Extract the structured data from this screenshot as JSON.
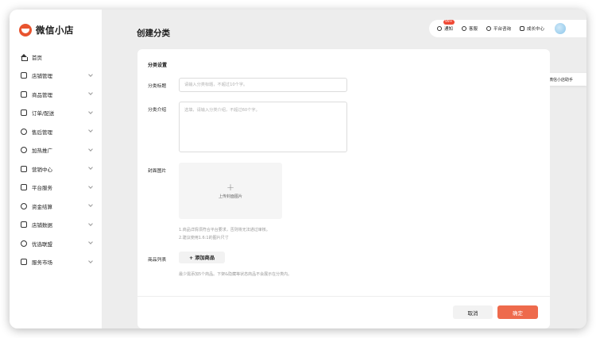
{
  "brand": {
    "name": "微信小店",
    "color": "#e8542f"
  },
  "sidebar": {
    "items": [
      {
        "label": "首页",
        "icon": "home-icon",
        "expandable": false
      },
      {
        "label": "店铺管理",
        "icon": "shop-icon",
        "expandable": true
      },
      {
        "label": "商品管理",
        "icon": "bag-icon",
        "expandable": true
      },
      {
        "label": "订单/配送",
        "icon": "order-icon",
        "expandable": true
      },
      {
        "label": "售后管理",
        "icon": "headset-icon",
        "expandable": true
      },
      {
        "label": "加热推广",
        "icon": "share-icon",
        "expandable": true
      },
      {
        "label": "营销中心",
        "icon": "ticket-icon",
        "expandable": true
      },
      {
        "label": "平台服务",
        "icon": "briefcase-icon",
        "expandable": true
      },
      {
        "label": "资金结算",
        "icon": "coin-icon",
        "expandable": true
      },
      {
        "label": "店铺数据",
        "icon": "chart-icon",
        "expandable": true
      },
      {
        "label": "优选联盟",
        "icon": "network-icon",
        "expandable": true
      },
      {
        "label": "服务市场",
        "icon": "grid-icon",
        "expandable": true
      }
    ]
  },
  "header": {
    "page_title": "创建分类",
    "notifications": {
      "label": "通知",
      "badge": "99+"
    },
    "service": {
      "label": "客服"
    },
    "consult": {
      "label": "平台咨询"
    },
    "growth": {
      "label": "成长中心"
    }
  },
  "float": {
    "download_label": "下载微信小店助手"
  },
  "form": {
    "section_title": "分类设置",
    "title_label": "分类标题",
    "title_placeholder": "请输入分类标题，不超过10个字。",
    "intro_label": "分类介绍",
    "intro_placeholder": "选填，请输入分类介绍，不超过60个字。",
    "cover_label": "封面图片",
    "upload_label": "上传封面图片",
    "cover_hint_1": "1.商品详情须符合平台要求，否则将无法通过审核。",
    "cover_hint_2": "2.建议使用1.6:1的图片尺寸",
    "products_label": "商品列表",
    "add_products_label": "+ 添加商品",
    "products_hint": "最少需添加5个商品。下架&隐藏等状态商品不会展示在分类内。"
  },
  "footer": {
    "cancel_label": "取消",
    "confirm_label": "确定",
    "confirm_color": "#ee6a4c"
  }
}
